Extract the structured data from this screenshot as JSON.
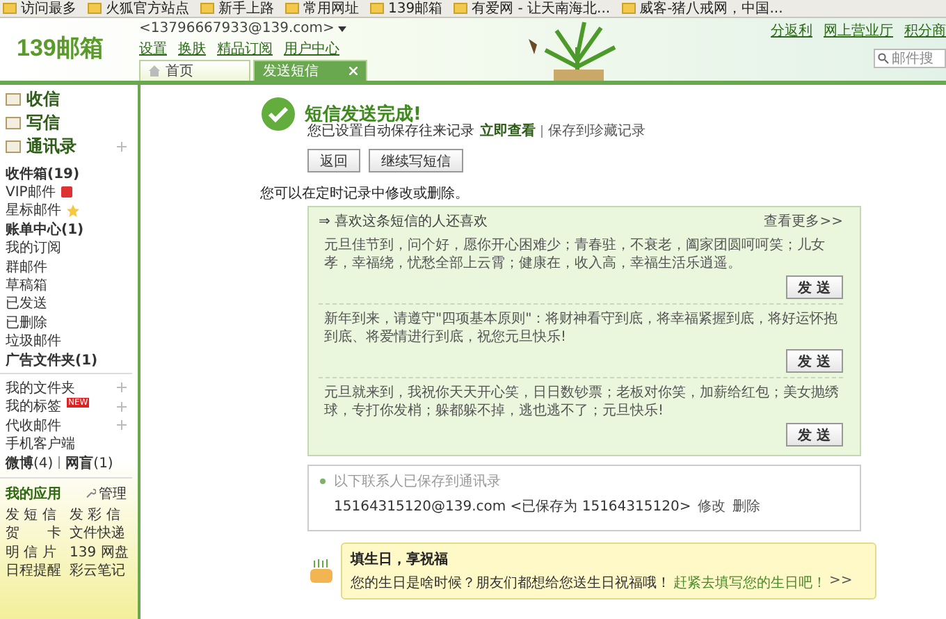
{
  "bookmarks": [
    "访问最多",
    "火狐官方站点",
    "新手上路",
    "常用网址",
    "139邮箱",
    "有爱网 - 让天南海北...",
    "威客-猪八戒网，中国..."
  ],
  "header": {
    "logo": "139邮箱",
    "account": "<13796667933@139.com>",
    "links": [
      "设置",
      "换肤",
      "精品订阅",
      "用户中心"
    ],
    "top_links": [
      "分返利",
      "网上营业厅",
      "积分商"
    ],
    "search": {
      "placeholder": "邮件搜"
    }
  },
  "tabs": [
    {
      "label": "首页",
      "selected": false,
      "closable": false
    },
    {
      "label": "发送短信",
      "selected": true,
      "closable": true
    }
  ],
  "sidebar": {
    "main": [
      {
        "label": "收信",
        "plus": false
      },
      {
        "label": "写信",
        "plus": false
      },
      {
        "label": "通讯录",
        "plus": true
      }
    ],
    "folders": [
      {
        "label": "收件箱(19)",
        "bold": true,
        "kind": "plain"
      },
      {
        "label": "VIP邮件",
        "bold": false,
        "kind": "vip"
      },
      {
        "label": "星标邮件",
        "bold": false,
        "kind": "star"
      },
      {
        "label": "账单中心(1)",
        "bold": true,
        "kind": "plain"
      },
      {
        "label": "我的订阅",
        "bold": false,
        "kind": "plain"
      },
      {
        "label": "群邮件",
        "bold": false,
        "kind": "plain"
      },
      {
        "label": "草稿箱",
        "bold": false,
        "kind": "plain"
      },
      {
        "label": "已发送",
        "bold": false,
        "kind": "plain"
      },
      {
        "label": "已删除",
        "bold": false,
        "kind": "plain"
      },
      {
        "label": "垃圾邮件",
        "bold": false,
        "kind": "plain"
      },
      {
        "label": "广告文件夹(1)",
        "bold": true,
        "kind": "plain"
      }
    ],
    "extras": [
      {
        "label": "我的文件夹",
        "plus": true
      },
      {
        "label": "我的标签",
        "plus": true,
        "badge": "NEW"
      },
      {
        "label": "代收邮件",
        "plus": true
      },
      {
        "label": "手机客户端",
        "plus": false
      }
    ],
    "social": [
      "**微博**(4)",
      "**网盲**(1)"
    ],
    "apps_title": "我的应用",
    "apps_manage": "管理",
    "apps": [
      [
        "发 短 信",
        "发 彩 信"
      ],
      [
        "贺　　卡",
        "文件快递"
      ],
      [
        "明 信 片",
        "139 网盘"
      ],
      [
        "日程提醒",
        "彩云笔记"
      ]
    ]
  },
  "result": {
    "title": "短信发送完成!",
    "note": "您已设置自动保存往来记录",
    "view_link": "立即查看",
    "save_link": "保存到珍藏记录",
    "buttons": [
      "返回",
      "继续写短信"
    ],
    "hint": "您可以在定时记录中修改或删除。"
  },
  "suggest": {
    "title": "⇒ 喜欢这条短信的人还喜欢",
    "more": "查看更多>>",
    "messages": [
      {
        "text": "元旦佳节到，问个好，愿你开心困难少；青春驻，不衰老，阖家团圆呵呵笑；儿女孝，幸福绕，忧愁全部上云霄；健康在，收入高，幸福生活乐逍遥。",
        "button": "发 送"
      },
      {
        "text": "新年到来，请遵守\"四项基本原则\"：将财神看守到底，将幸福紧握到底，将好运怀抱到底、将爱情进行到底，祝您元旦快乐!",
        "button": "发 送"
      },
      {
        "text": "元旦就来到，我祝你天天开心笑，日日数钞票；老板对你笑，加薪给红包；美女抛绣球，专打你发梢；躲都躲不掉，逃也逃不了；元旦快乐!",
        "button": "发 送"
      }
    ]
  },
  "contacts": {
    "title": "以下联系人已保存到通讯录",
    "entry": "15164315120@139.com <已保存为 15164315120>",
    "edit": "修改",
    "delete": "删除"
  },
  "birthday": {
    "title": "填生日，享祝福",
    "text": "您的生日是啥时候？朋友们都想给您送生日祝福哦！",
    "link": "赶紧去填写您的生日吧！",
    "more": ">>"
  }
}
